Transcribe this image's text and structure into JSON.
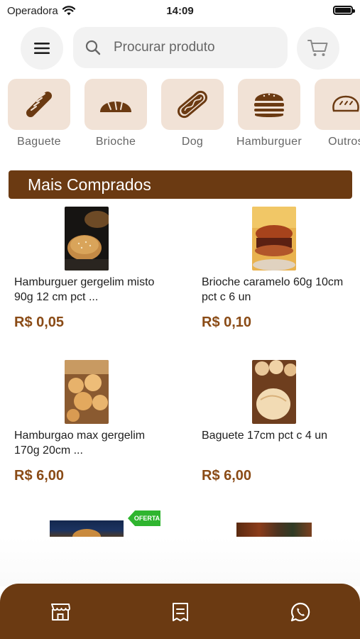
{
  "status_bar": {
    "carrier": "Operadora",
    "time": "14:09",
    "wifi_icon": "wifi-icon",
    "battery_icon": "battery-icon"
  },
  "header": {
    "menu_icon": "hamburger-menu-icon",
    "search": {
      "placeholder": "Procurar produto",
      "icon": "search-icon"
    },
    "cart_icon": "cart-icon"
  },
  "categories": [
    {
      "label": "Baguete",
      "icon": "baguette-icon"
    },
    {
      "label": "Brioche",
      "icon": "brioche-bread-icon"
    },
    {
      "label": "Dog",
      "icon": "hot-dog-icon"
    },
    {
      "label": "Hamburguer",
      "icon": "hamburger-icon"
    },
    {
      "label": "Outros",
      "icon": "bread-loaf-icon"
    }
  ],
  "section": {
    "title": "Mais Comprados"
  },
  "products": [
    {
      "name": "Hamburguer gergelim misto 90g 12 cm pct ...",
      "price": "R$ 0,05"
    },
    {
      "name": "Brioche caramelo 60g 10cm pct c 6 un",
      "price": "R$ 0,10"
    },
    {
      "name": "Hamburgao max gergelim 170g 20cm ...",
      "price": "R$ 6,00"
    },
    {
      "name": "Baguete 17cm pct c 4 un",
      "price": "R$ 6,00"
    }
  ],
  "offer_badge": "OFERTA",
  "bottom_nav": [
    {
      "icon": "store-icon"
    },
    {
      "icon": "orders-receipt-icon"
    },
    {
      "icon": "whatsapp-icon"
    }
  ],
  "colors": {
    "brand_brown": "#6b3a12",
    "price_brown": "#8a4b16",
    "category_bg": "#f1e2d6",
    "offer_green": "#2fb52f"
  }
}
